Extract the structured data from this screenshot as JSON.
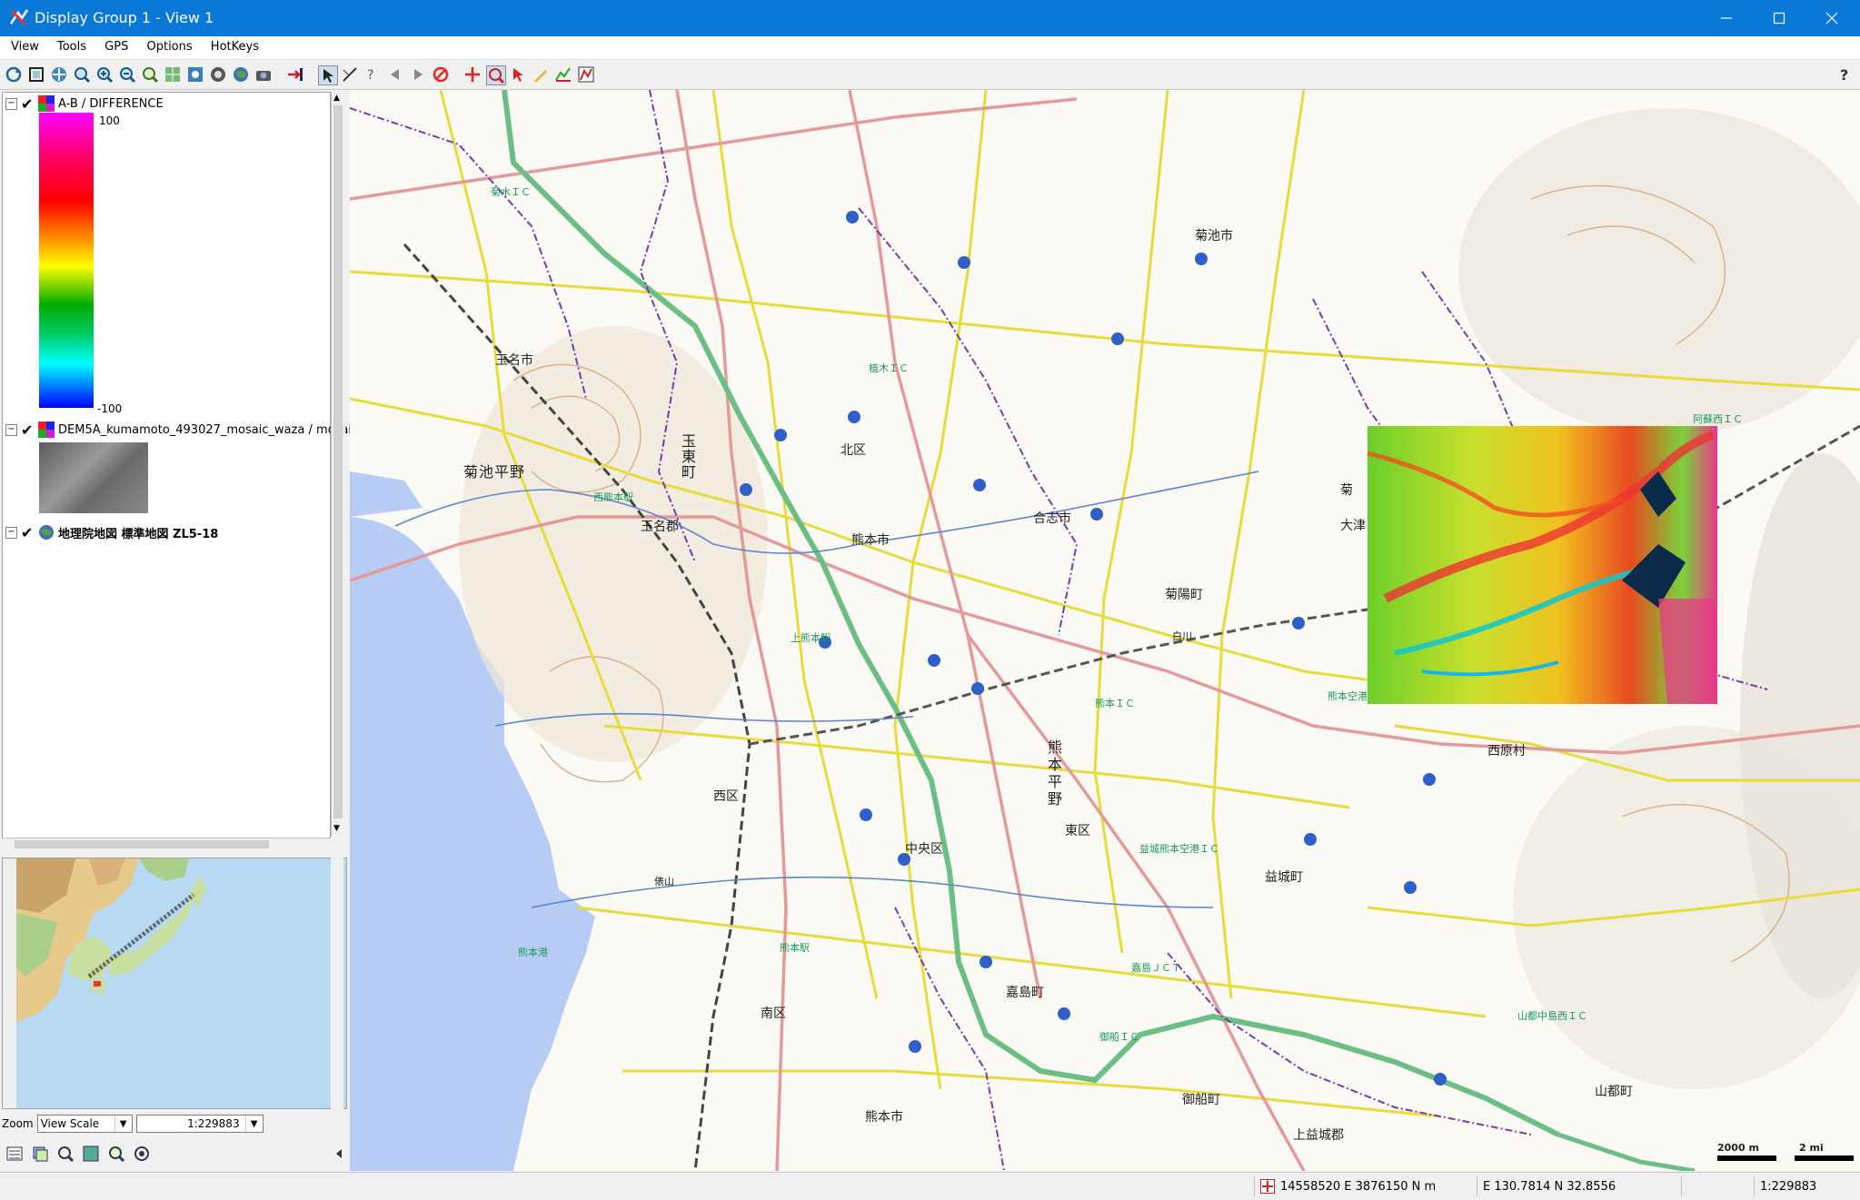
{
  "window": {
    "title": "Display Group 1 - View 1"
  },
  "menu": [
    "View",
    "Tools",
    "GPS",
    "Options",
    "HotKeys"
  ],
  "layers": [
    {
      "name": "A-B / DIFFERENCE",
      "legend_max": "100",
      "legend_min": "-100"
    },
    {
      "name": "DEM5A_kumamoto_493027_mosaic_waza / mosaic"
    },
    {
      "name": "地理院地図 標準地図 ZL5-18"
    }
  ],
  "zoom": {
    "label": "Zoom",
    "mode": "View Scale",
    "value": "1:229883"
  },
  "map_labels": {
    "kikuchi_city": "菊池市",
    "tamana_city": "玉名市",
    "kikuchi_heiya": "菊池平野",
    "tamatocho": "玉東町",
    "tamana_gun": "玉名郡",
    "kita_ku": "北区",
    "kumamoto_city": "熊本市",
    "koshi_city": "合志市",
    "kikuyo": "菊陽町",
    "ozu": "大津",
    "kikuchi2": "菊",
    "nishi_ku": "西区",
    "kumamoto_heiya": "熊本平野",
    "higashi_ku": "東区",
    "chuo_ku": "中央区",
    "minami_ku": "南区",
    "kashima": "嘉島町",
    "mashiki": "益城町",
    "mifune": "御船町",
    "kumamoto_city2": "熊本市",
    "nishihara": "西原村",
    "yamato": "山都町",
    "kamimashiki": "上益城郡",
    "kumamoto_ic": "熊本ＩＣ",
    "ueki_ic": "植木ＩＣ",
    "kikusui_ic": "菊水ＩＣ",
    "kumamoto_airport_ic": "益城熊本空港ＩＣ",
    "mifune_ic": "御船ＩＣ",
    "kashima_jct": "嘉島ＪＣＴ",
    "aso_ic": "阿蘇西ＩＣ",
    "yamato_ic": "山都中島西ＩＣ",
    "kumamoto_port": "熊本港",
    "shirakawa": "白川",
    "kumamoto_airport": "熊本空港",
    "tawarayama": "俵山",
    "nishi_kumamoto_stn": "西熊本駅",
    "kumamoto_stn": "熊本駅",
    "kamikumamoto_stn": "上熊本駅",
    "scale_m": "2000 m",
    "scale_mi": "2 mi"
  },
  "status": {
    "utm": "14558520 E  3876150 N m",
    "latlon": "E 130.7814  N 32.8556",
    "scale": "1:229883"
  },
  "colors": {
    "titlebar": "#0a78d7",
    "water": "#b8cdf5",
    "highway": "#6cbf84",
    "road_major": "#e8dc3c",
    "road_national": "#e89898"
  }
}
